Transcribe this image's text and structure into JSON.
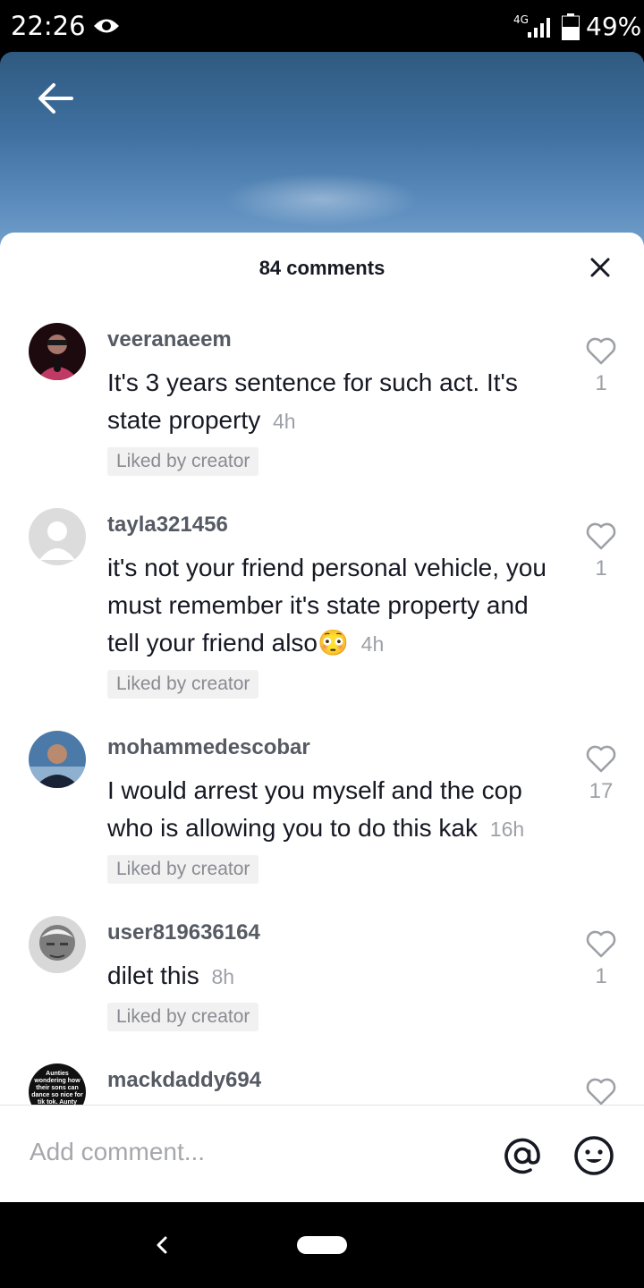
{
  "status_bar": {
    "time": "22:26",
    "network": "4G",
    "battery": "49%"
  },
  "sheet": {
    "title": "84 comments"
  },
  "comments": [
    {
      "username": "veeranaeem",
      "text": "It's 3 years sentence for such act. It's state property",
      "time": "4h",
      "badge": "Liked by creator",
      "likes": "1"
    },
    {
      "username": "tayla321456",
      "text": "it's not your friend personal vehicle, you must remember it's state property and tell your friend also😳",
      "time": "4h",
      "badge": "Liked by creator",
      "likes": "1"
    },
    {
      "username": "mohammedescobar",
      "text": "I would arrest you myself and the cop who is allowing you to do this kak",
      "time": "16h",
      "badge": "Liked by creator",
      "likes": "17"
    },
    {
      "username": "user819636164",
      "text": "dilet this",
      "time": "8h",
      "badge": "Liked by creator",
      "likes": "1"
    },
    {
      "username": "mackdaddy694",
      "avatar_caption": "Aunties wondering how their sons can dance so nice for tik tok. Aunty your"
    }
  ],
  "input": {
    "placeholder": "Add comment..."
  },
  "colors": {
    "text_primary": "#161823",
    "text_secondary": "#9da0a6",
    "badge_bg": "#f1f1f2"
  },
  "icons": [
    "eye-icon",
    "signal-icon",
    "battery-icon",
    "back-arrow-icon",
    "close-icon",
    "heart-icon",
    "at-icon",
    "emoji-icon",
    "nav-back-icon",
    "nav-home-icon"
  ]
}
